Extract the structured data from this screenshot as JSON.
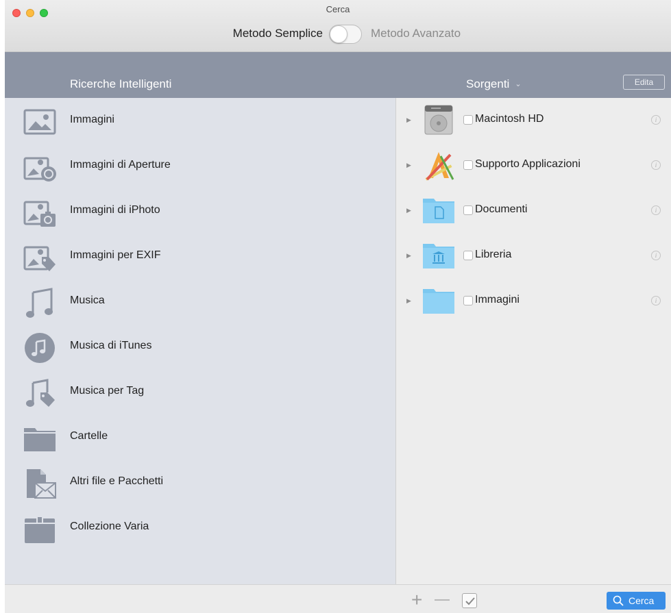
{
  "window": {
    "title": "Cerca"
  },
  "mode_switch": {
    "left_label": "Metodo Semplice",
    "right_label": "Metodo Avanzato"
  },
  "header": {
    "left_title": "Ricerche Intelligenti",
    "right_title": "Sorgenti",
    "edit_label": "Edita"
  },
  "smart_searches": [
    {
      "label": "Immagini",
      "icon": "image-icon"
    },
    {
      "label": "Immagini di Aperture",
      "icon": "aperture-images-icon"
    },
    {
      "label": "Immagini di iPhoto",
      "icon": "iphoto-images-icon"
    },
    {
      "label": "Immagini per EXIF",
      "icon": "exif-images-icon"
    },
    {
      "label": "Musica",
      "icon": "music-note-icon"
    },
    {
      "label": "Musica di iTunes",
      "icon": "itunes-icon"
    },
    {
      "label": "Musica per Tag",
      "icon": "music-tag-icon"
    },
    {
      "label": "Cartelle",
      "icon": "folder-icon"
    },
    {
      "label": "Altri file e Pacchetti",
      "icon": "file-package-icon"
    },
    {
      "label": "Collezione Varia",
      "icon": "box-icon"
    }
  ],
  "sources": [
    {
      "label": "Macintosh HD",
      "icon": "hard-disk-icon"
    },
    {
      "label": "Supporto Applicazioni",
      "icon": "applications-icon"
    },
    {
      "label": "Documenti",
      "icon": "documents-folder-icon"
    },
    {
      "label": "Libreria",
      "icon": "library-folder-icon"
    },
    {
      "label": "Immagini",
      "icon": "pictures-folder-icon"
    }
  ],
  "footer": {
    "search_label": "Cerca"
  },
  "colors": {
    "header_bar": "#8c94a4",
    "left_panel": "#dfe2e9",
    "search_button": "#3a8ee6",
    "folder_blue": "#7cc8f0"
  }
}
